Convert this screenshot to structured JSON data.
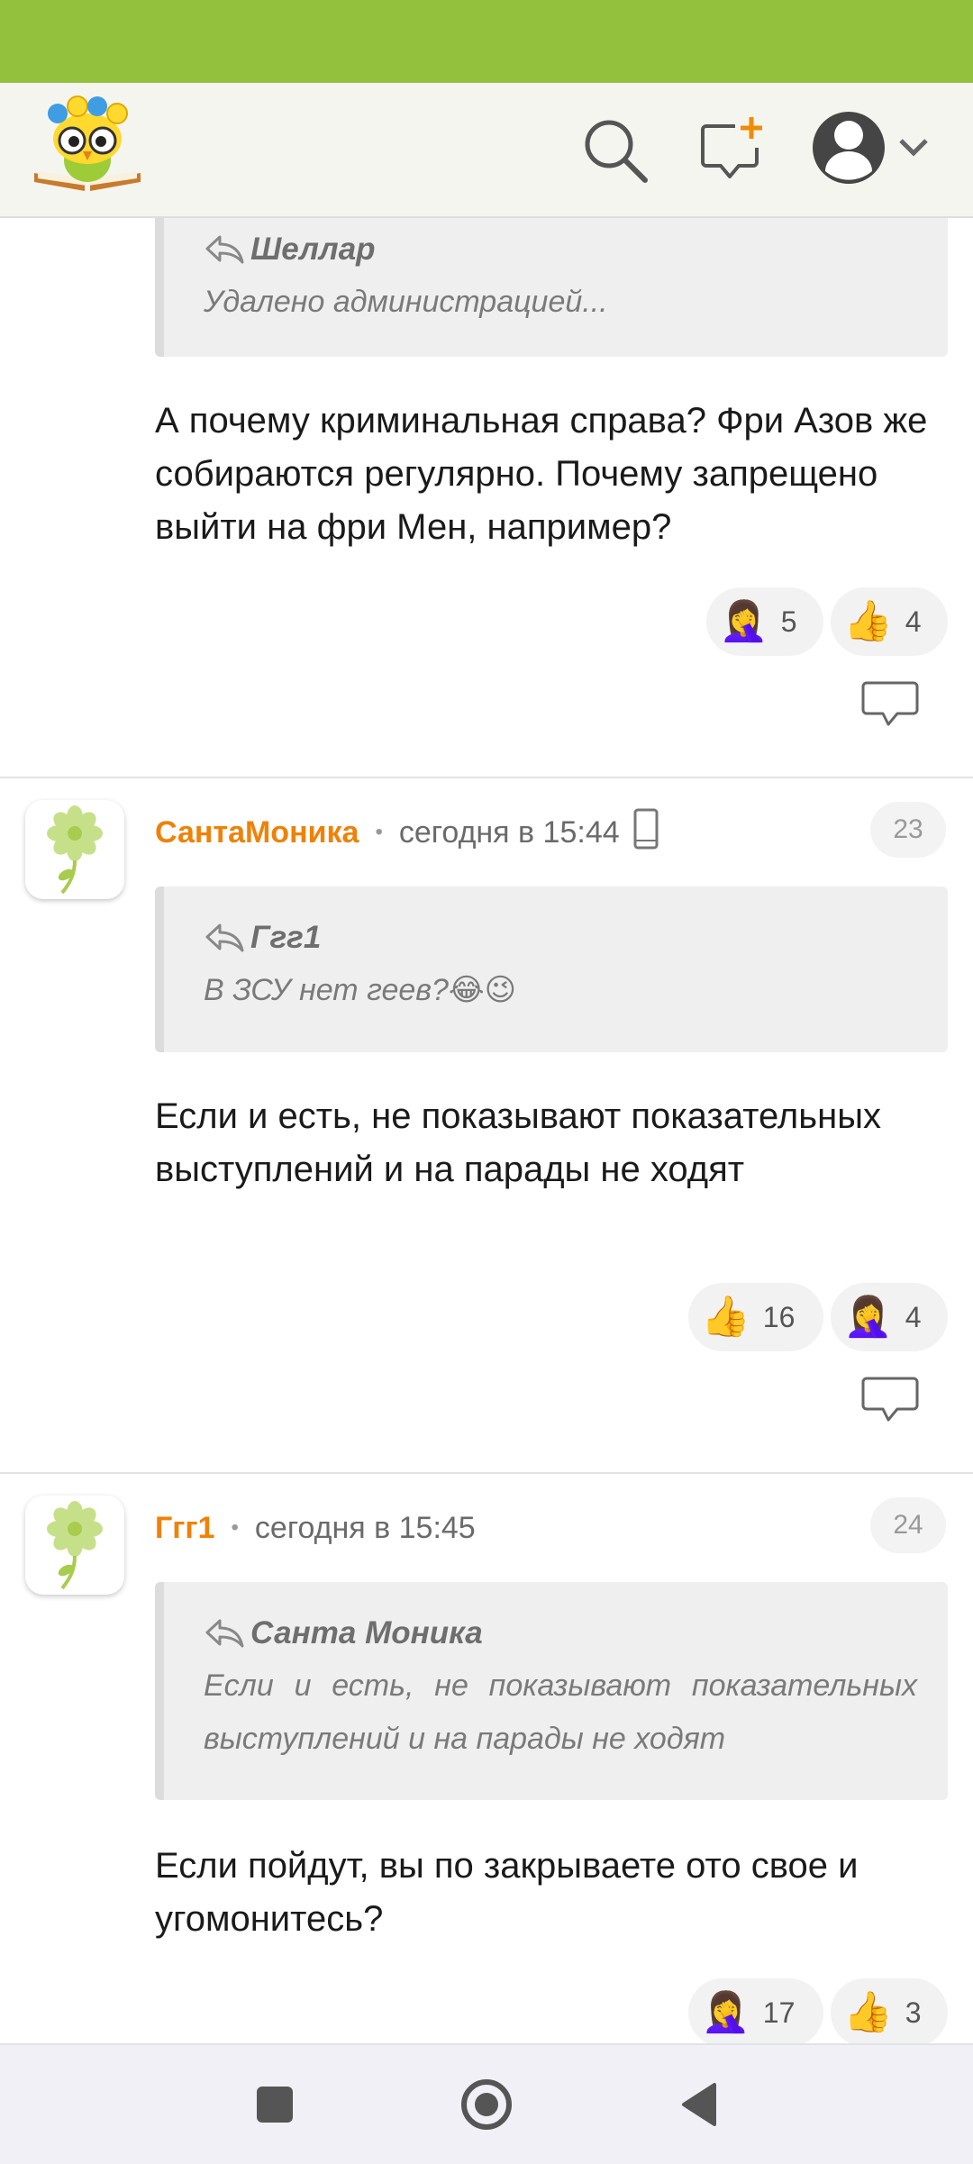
{
  "header": {
    "logo_icon": "owl-book-logo",
    "search_icon": "search-icon",
    "new_message_icon": "new-message-icon",
    "profile_icon": "user-avatar-icon",
    "dropdown_icon": "chevron-down-icon"
  },
  "comments": [
    {
      "quote": {
        "author": "Шеллар",
        "text": "Удалено администрацией..."
      },
      "text": "А почему криминальная справа? Фри Азов же собираются регулярно. Почему запрещено выйти на фри Мен, например?",
      "reactions": [
        {
          "emoji": "🤦‍♀️",
          "count": "5"
        },
        {
          "emoji": "👍",
          "count": "4"
        }
      ]
    },
    {
      "username": "СантаМоника",
      "time": "сегодня в 15:44",
      "number": "23",
      "device_icon": "mobile-phone-icon",
      "quote": {
        "author": "Ггг1",
        "text": "В ЗСУ нет геев?😂😉"
      },
      "text": "Если и есть, не показывают показательных выступлений и на парады не ходят",
      "reactions": [
        {
          "emoji": "👍",
          "count": "16"
        },
        {
          "emoji": "🤦‍♀️",
          "count": "4"
        }
      ]
    },
    {
      "username": "Ггг1",
      "time": "сегодня в 15:45",
      "number": "24",
      "quote": {
        "author": "Санта Моника",
        "text": "Если и есть, не показывают показательных выступлений и на парады не ходят"
      },
      "text": "Если пойдут, вы по закрываете ото свое и угомонитесь?",
      "reactions": [
        {
          "emoji": "🤦‍♀️",
          "count": "17"
        },
        {
          "emoji": "👍",
          "count": "3"
        }
      ]
    }
  ],
  "colors": {
    "status_bar": "#94c13d",
    "username": "#ee8208",
    "header_bg": "#f5f5f0"
  },
  "nav": {
    "recent_icon": "square-recents-icon",
    "home_icon": "circle-home-icon",
    "back_icon": "triangle-back-icon"
  }
}
